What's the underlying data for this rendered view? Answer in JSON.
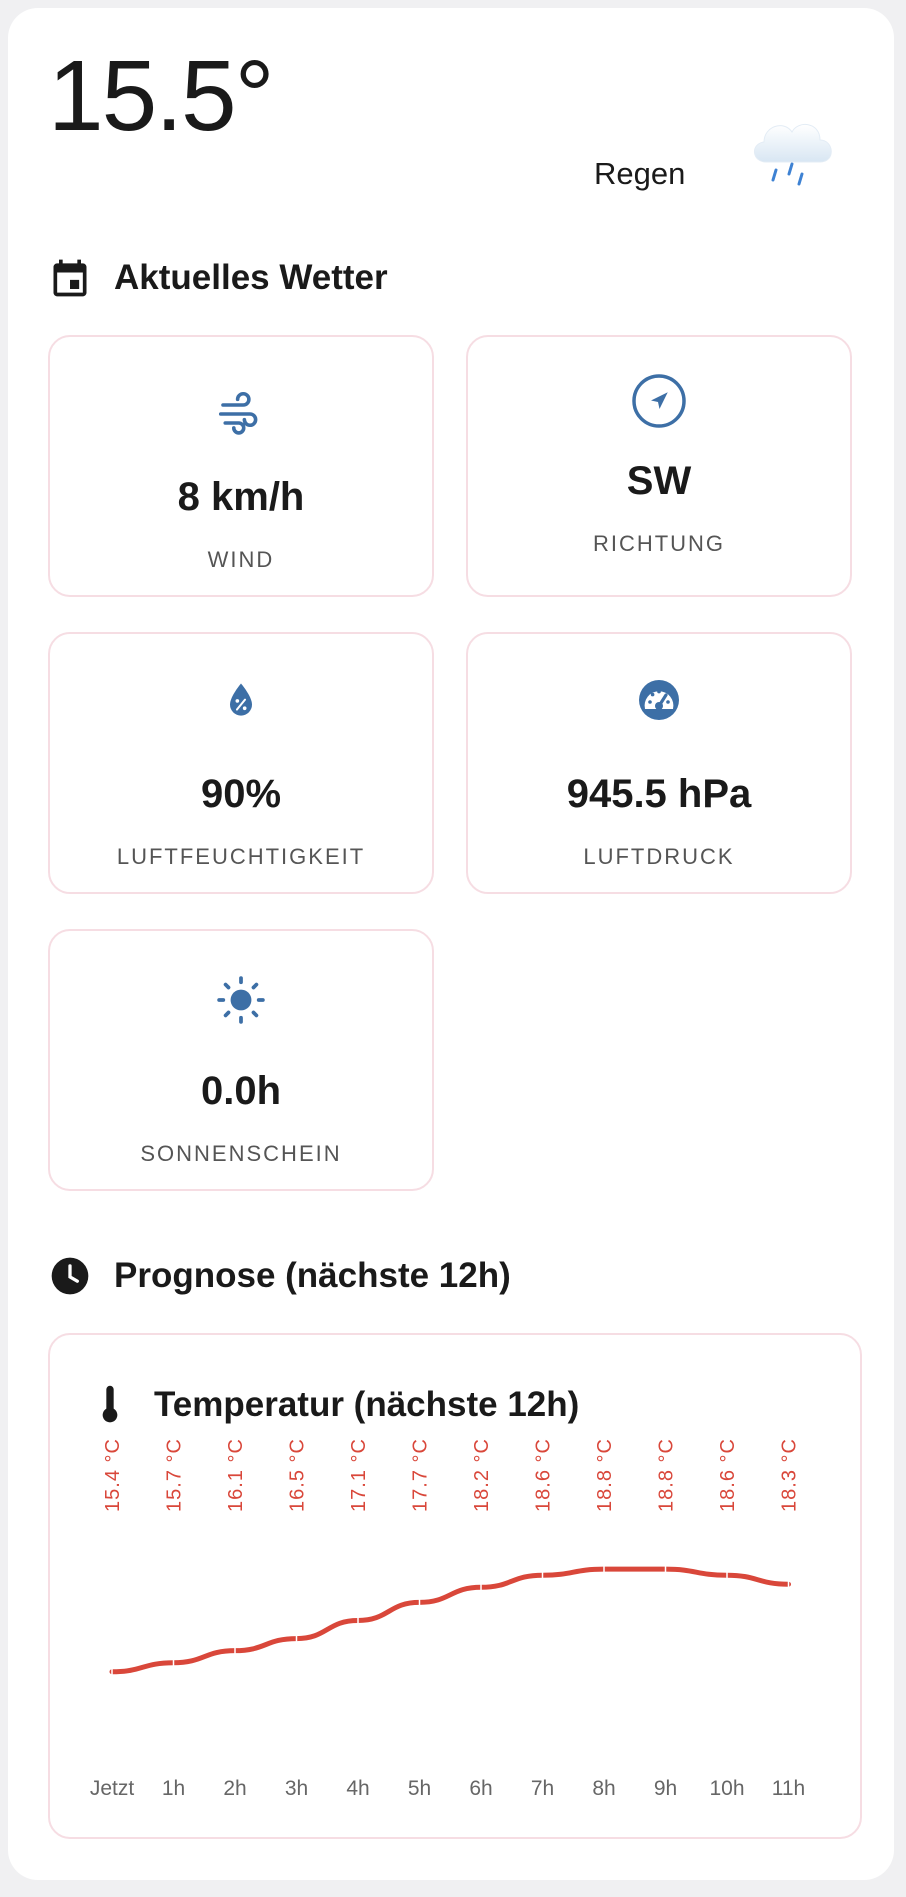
{
  "current": {
    "temperature": "15.5°",
    "condition": "Regen",
    "condition_icon": "rain-cloud-icon"
  },
  "sections": {
    "current_weather": "Aktuelles Wetter",
    "forecast": "Prognose (nächste 12h)"
  },
  "tiles": {
    "wind": {
      "value": "8 km/h",
      "label": "WIND",
      "icon": "wind-icon"
    },
    "direction": {
      "value": "SW",
      "label": "RICHTUNG",
      "icon": "compass-icon"
    },
    "humidity": {
      "value": "90%",
      "label": "LUFTFEUCHTIGKEIT",
      "icon": "humidity-drop-icon"
    },
    "pressure": {
      "value": "945.5 hPa",
      "label": "LUFTDRUCK",
      "icon": "gauge-icon"
    },
    "sunshine": {
      "value": "0.0h",
      "label": "SONNENSCHEIN",
      "icon": "sun-icon"
    }
  },
  "colors": {
    "accent": "#3d6fa6",
    "chart_line": "#d9473a",
    "card_border": "#f6dde3"
  },
  "chart_data": {
    "type": "line",
    "title": "Temperatur (nächste 12h)",
    "x": [
      "Jetzt",
      "1h",
      "2h",
      "3h",
      "4h",
      "5h",
      "6h",
      "7h",
      "8h",
      "9h",
      "10h",
      "11h"
    ],
    "values": [
      15.4,
      15.7,
      16.1,
      16.5,
      17.1,
      17.7,
      18.2,
      18.6,
      18.8,
      18.8,
      18.6,
      18.3
    ],
    "value_labels": [
      "15.4 °C",
      "15.7 °C",
      "16.1 °C",
      "16.5 °C",
      "17.1 °C",
      "17.7 °C",
      "18.2 °C",
      "18.6 °C",
      "18.8 °C",
      "18.8 °C",
      "18.6 °C",
      "18.3 °C"
    ],
    "ylim": [
      14.3,
      19.6
    ],
    "grid": false
  }
}
